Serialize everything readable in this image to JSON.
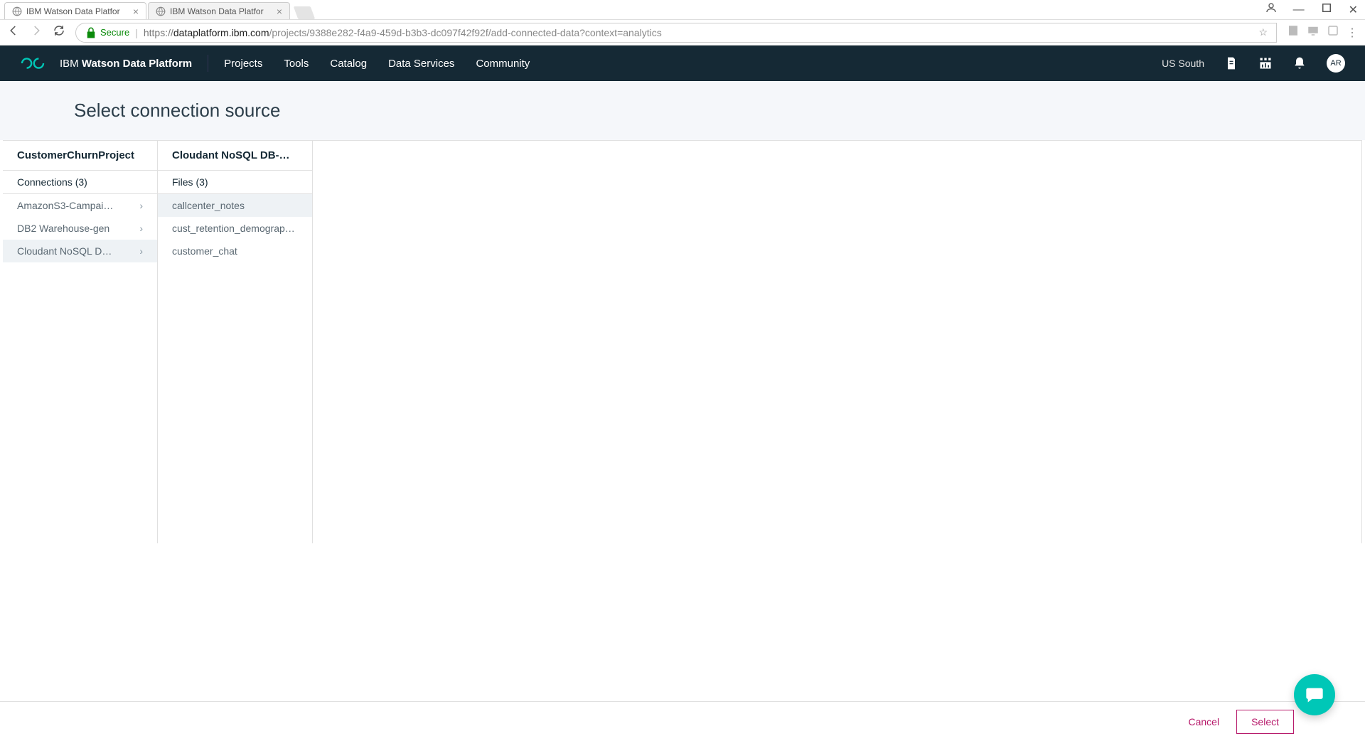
{
  "browser": {
    "tabs": [
      {
        "title": "IBM Watson Data Platfor",
        "active": true
      },
      {
        "title": "IBM Watson Data Platfor",
        "active": false
      }
    ],
    "secure_label": "Secure",
    "url_scheme": "https://",
    "url_domain": "dataplatform.ibm.com",
    "url_path": "/projects/9388e282-f4a9-459d-b3b3-dc097f42f92f/add-connected-data?context=analytics"
  },
  "header": {
    "brand_prefix": "IBM",
    "brand_main": "Watson Data Platform",
    "nav": [
      "Projects",
      "Tools",
      "Catalog",
      "Data Services",
      "Community"
    ],
    "region": "US South",
    "avatar": "AR"
  },
  "page": {
    "title": "Select connection source"
  },
  "col1": {
    "header": "CustomerChurnProject",
    "sub": "Connections (3)",
    "items": [
      "AmazonS3-Campai…",
      "DB2 Warehouse-gen",
      "Cloudant NoSQL D…"
    ],
    "selected_index": 2
  },
  "col2": {
    "header": "Cloudant NoSQL DB-…",
    "sub": "Files (3)",
    "items": [
      "callcenter_notes",
      "cust_retention_demograp…",
      "customer_chat"
    ],
    "selected_index": 0
  },
  "footer": {
    "cancel": "Cancel",
    "select": "Select"
  }
}
